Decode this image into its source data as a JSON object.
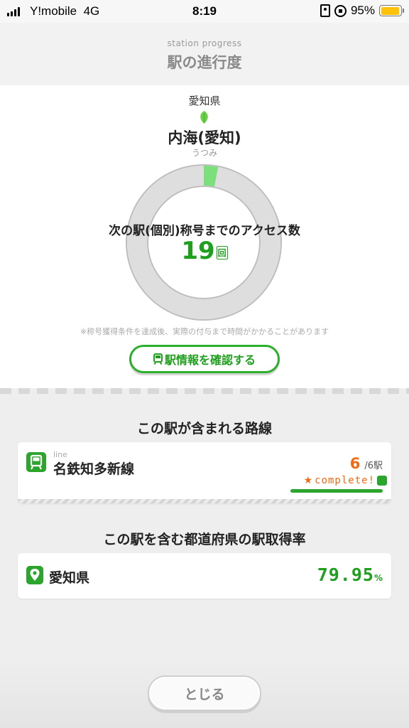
{
  "status_bar": {
    "carrier": "Y!mobile",
    "network": "4G",
    "time": "8:19",
    "battery_percent": "95%",
    "battery_level": 0.95
  },
  "header": {
    "subtitle": "station progress",
    "title": "駅の進行度"
  },
  "station": {
    "prefecture": "愛知県",
    "name": "内海(愛知)",
    "kana": "うつみ",
    "access_label": "次の駅(個別)称号までのアクセス数",
    "access_count": "19",
    "access_unit": "回",
    "progress_fraction": 0.03,
    "note": "※称号獲得条件を達成後、実際の付与まで時間がかかることがあります",
    "info_button": "駅情報を確認する"
  },
  "lines_section": {
    "title": "この駅が含まれる路線",
    "items": [
      {
        "sub_label": "line",
        "name": "名鉄知多新線",
        "acquired": "6",
        "total_text": "/6駅",
        "complete_text": "complete!"
      }
    ]
  },
  "pref_section": {
    "title": "この駅を含む都道府県の駅取得率",
    "prefecture": "愛知県",
    "rate": "79.95",
    "rate_unit": "%"
  },
  "footer": {
    "close_button": "とじる"
  },
  "colors": {
    "accent_green": "#1ea01e",
    "accent_orange": "#f06a14",
    "progress_green": "#7be07b",
    "ring_gray": "#dedede"
  }
}
